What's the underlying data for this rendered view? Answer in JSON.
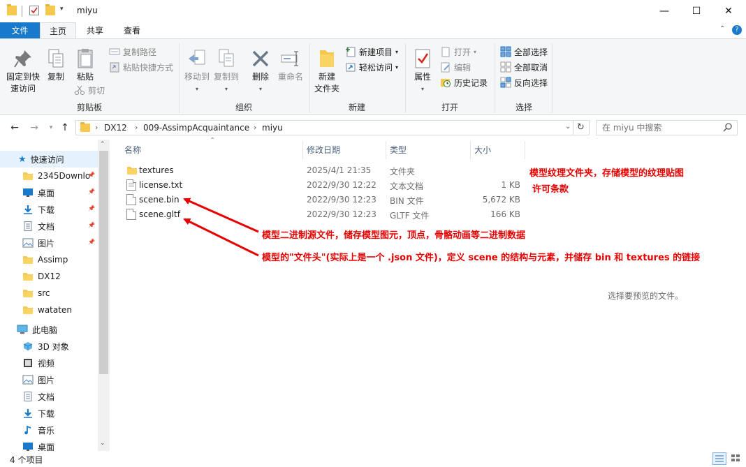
{
  "window": {
    "title": "miyu",
    "controls": {
      "minimize": "—",
      "maximize": "☐",
      "close": "✕"
    }
  },
  "ribbon": {
    "tabs": [
      {
        "label": "文件",
        "active": false
      },
      {
        "label": "主页",
        "active": true
      },
      {
        "label": "共享",
        "active": false
      },
      {
        "label": "查看",
        "active": false
      }
    ],
    "groups": {
      "clipboard": {
        "label": "剪贴板",
        "pin_quick_access": "固定到快\n速访问",
        "copy": "复制",
        "paste": "粘贴",
        "copy_path": "复制路径",
        "paste_shortcut": "粘贴快捷方式",
        "cut": "剪切"
      },
      "organize": {
        "label": "组织",
        "move_to": "移动到",
        "copy_to": "复制到",
        "delete": "删除",
        "rename": "重命名"
      },
      "new": {
        "label": "新建",
        "new_folder": "新建\n文件夹",
        "new_item": "新建项目",
        "easy_access": "轻松访问"
      },
      "open": {
        "label": "打开",
        "properties": "属性",
        "open": "打开",
        "edit": "编辑",
        "history": "历史记录"
      },
      "select": {
        "label": "选择",
        "select_all": "全部选择",
        "select_none": "全部取消",
        "invert": "反向选择"
      }
    }
  },
  "address": {
    "crumbs": [
      "DX12",
      "009-AssimpAcquaintance",
      "miyu"
    ],
    "search_placeholder": "在 miyu 中搜索"
  },
  "nav_pane": {
    "quick_access_label": "快速访问",
    "quick_access": [
      {
        "label": "2345Downlo",
        "icon": "folder-icon",
        "pinned": true
      },
      {
        "label": "桌面",
        "icon": "desktop-icon",
        "pinned": true
      },
      {
        "label": "下载",
        "icon": "download-icon",
        "pinned": true
      },
      {
        "label": "文档",
        "icon": "document-icon",
        "pinned": true
      },
      {
        "label": "图片",
        "icon": "picture-icon",
        "pinned": true
      },
      {
        "label": "Assimp",
        "icon": "folder-icon",
        "pinned": false
      },
      {
        "label": "DX12",
        "icon": "folder-icon",
        "pinned": false
      },
      {
        "label": "src",
        "icon": "folder-icon",
        "pinned": false
      },
      {
        "label": "wataten",
        "icon": "folder-icon",
        "pinned": false
      }
    ],
    "this_pc_label": "此电脑",
    "this_pc": [
      {
        "label": "3D 对象",
        "icon": "3d-objects-icon"
      },
      {
        "label": "视频",
        "icon": "video-icon"
      },
      {
        "label": "图片",
        "icon": "picture-icon"
      },
      {
        "label": "文档",
        "icon": "document-icon"
      },
      {
        "label": "下载",
        "icon": "download-icon"
      },
      {
        "label": "音乐",
        "icon": "music-icon"
      },
      {
        "label": "桌面",
        "icon": "desktop-icon"
      }
    ]
  },
  "file_list": {
    "columns": [
      "名称",
      "修改日期",
      "类型",
      "大小"
    ],
    "rows": [
      {
        "name": "textures",
        "date": "2025/4/1 21:35",
        "type": "文件夹",
        "size": "",
        "icon": "folder-icon"
      },
      {
        "name": "license.txt",
        "date": "2022/9/30 12:22",
        "type": "文本文档",
        "size": "1 KB",
        "icon": "text-file-icon"
      },
      {
        "name": "scene.bin",
        "date": "2022/9/30 12:23",
        "type": "BIN 文件",
        "size": "5,672 KB",
        "icon": "file-icon"
      },
      {
        "name": "scene.gltf",
        "date": "2022/9/30 12:23",
        "type": "GLTF 文件",
        "size": "166 KB",
        "icon": "file-icon"
      }
    ]
  },
  "annotations": {
    "textures": "模型纹理文件夹，存储模型的纹理贴图",
    "license": "许可条款",
    "bin": "模型二进制源文件，储存模型图元，顶点，骨骼动画等二进制数据",
    "gltf": "模型的\"文件头\"(实际上是一个 .json 文件)，定义 scene 的结构与元素，并储存 bin 和 textures 的链接",
    "color": "#e60000"
  },
  "preview_text": "选择要预览的文件。",
  "status": {
    "item_count": "4 个项目"
  }
}
